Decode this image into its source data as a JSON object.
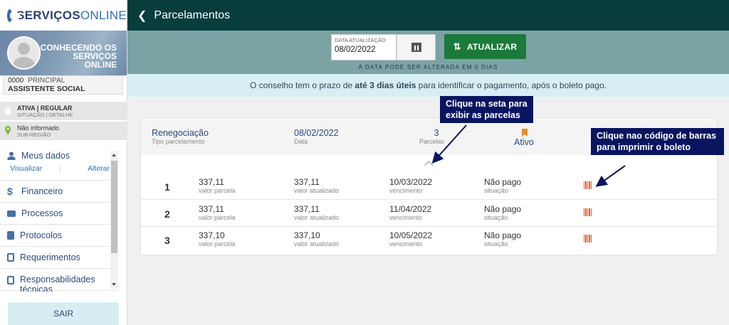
{
  "app": {
    "logo_part1": "SERVIÇOS",
    "logo_part2": "ONLINE"
  },
  "user": {
    "name": "CONHECENDO OS SERVIÇOS ONLINE",
    "reg_number": "0000",
    "reg_type": "PRINCIPAL",
    "role": "ASSISTENTE SOCIAL"
  },
  "status": {
    "situation": "ATIVA | REGULAR",
    "situation_label": "SITUAÇÃO | DETALHE",
    "region": "Não informado",
    "region_label": "SUB-REGIÃO"
  },
  "menu": {
    "meus_dados": "Meus dados",
    "visualizar": "Visualizar",
    "alterar": "Alterar",
    "items": [
      {
        "label": "Financeiro",
        "icon": "dollar-icon"
      },
      {
        "label": "Processos",
        "icon": "folder-icon"
      },
      {
        "label": "Protocolos",
        "icon": "document-icon"
      },
      {
        "label": "Requerimentos",
        "icon": "clipboard-icon"
      },
      {
        "label": "Responsabilidades técnicas",
        "icon": "clipboard-icon"
      }
    ],
    "logout": "SAIR"
  },
  "header": {
    "title": "Parcelamentos"
  },
  "toolbar": {
    "date_label": "DATA ATUALIZAÇÃO",
    "date_value": "08/02/2022",
    "update_button": "ATUALIZAR",
    "note": "A DATA PODE SER ALTERADA EM 0 DIAS"
  },
  "info": {
    "text_before": "O conselho tem o prazo de ",
    "text_bold": "até 3 dias úteis",
    "text_after": " para identificar o pagamento, após o boleto pago."
  },
  "card": {
    "type_value": "Renegociação",
    "type_label": "Tipo parcelamento",
    "date_value": "08/02/2022",
    "date_label": "Data",
    "installments_value": "3",
    "installments_label": "Parcelas",
    "status": "Ativo"
  },
  "installments": [
    {
      "num": "1",
      "value": "337,11",
      "updated": "337,11",
      "due": "10/03/2022",
      "situation": "Não pago"
    },
    {
      "num": "2",
      "value": "337,11",
      "updated": "337,11",
      "due": "11/04/2022",
      "situation": "Não pago"
    },
    {
      "num": "3",
      "value": "337,10",
      "updated": "337,10",
      "due": "10/05/2022",
      "situation": "Não pago"
    }
  ],
  "installment_labels": {
    "value": "valor parcela",
    "updated": "valor atualizado",
    "due": "vencimento",
    "situation": "situação"
  },
  "annotations": {
    "arrow_callout": "Clique na seta para exibir as parcelas",
    "barcode_callout": "Clique nao código de barras para imprimir o boleto"
  },
  "colors": {
    "topbar": "#093d3c",
    "toolband": "#7ba3a4",
    "update_button": "#1b7a3a",
    "info_band": "#d7eef2",
    "callout": "#0a1560",
    "barcode": "#e05a28",
    "status_badge": "#f08a24"
  }
}
